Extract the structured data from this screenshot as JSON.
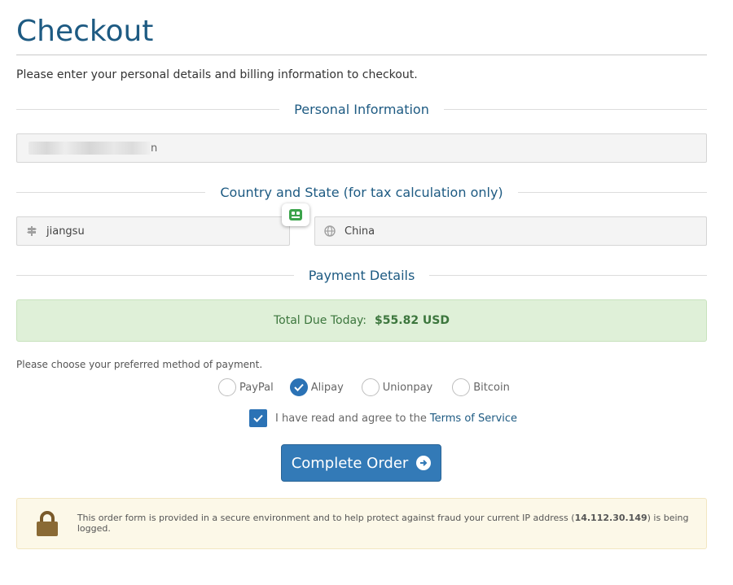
{
  "header": {
    "title": "Checkout",
    "intro": "Please enter your personal details and billing information to checkout."
  },
  "personal": {
    "heading": "Personal Information",
    "email_value_suffix": "n"
  },
  "location": {
    "heading": "Country and State (for tax calculation only)",
    "state_value": "jiangsu",
    "country_value": "China"
  },
  "payment": {
    "heading": "Payment Details",
    "total_label": "Total Due Today:",
    "total_amount": "$55.82 USD",
    "prompt": "Please choose your preferred method of payment.",
    "methods": [
      {
        "label": "PayPal",
        "selected": false
      },
      {
        "label": "Alipay",
        "selected": true
      },
      {
        "label": "Unionpay",
        "selected": false
      },
      {
        "label": "Bitcoin",
        "selected": false
      }
    ],
    "agree_text": "I have read and agree to the",
    "terms_link": "Terms of Service",
    "agree_checked": true,
    "complete_label": "Complete Order"
  },
  "security": {
    "message_start": "This order form is provided in a secure environment and to help protect against fraud your current IP address (",
    "ip": "14.112.30.149",
    "message_end": ") is being logged."
  },
  "colors": {
    "accent": "#1d5a82",
    "button": "#337ab7",
    "success_bg": "#dff0d8",
    "warning_bg": "#fcf8e8"
  },
  "icons": [
    "signpost-icon",
    "globe-icon",
    "robot-icon",
    "check-icon",
    "arrow-circle-right-icon",
    "lock-icon"
  ]
}
